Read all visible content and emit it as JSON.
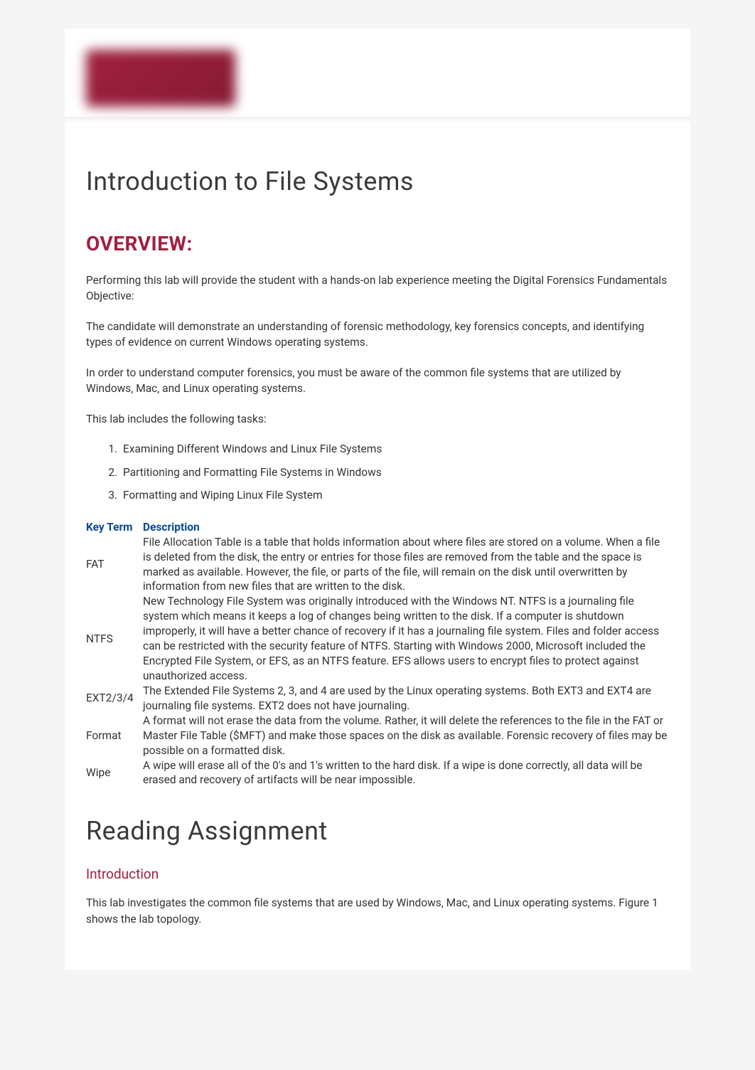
{
  "logo": {
    "alt": "INFOSEC"
  },
  "title": "Introduction to File Systems",
  "overview": {
    "heading": "OVERVIEW:",
    "p1": "Performing this lab will provide the student with a hands-on lab experience meeting the Digital Forensics Fundamentals Objective:",
    "p2": "The candidate will demonstrate an understanding of forensic methodology, key forensics concepts, and identifying types of evidence on current Windows operating systems.",
    "p3": "In order to understand computer forensics, you must be aware of the common file systems that are utilized by Windows, Mac, and Linux operating systems.",
    "p4": "This lab includes the following tasks:",
    "tasks": [
      "Examining Different Windows and Linux File Systems",
      "Partitioning and Formatting File Systems in Windows",
      "Formatting and Wiping Linux File System"
    ]
  },
  "keyTerms": {
    "header": {
      "term": "Key Term",
      "desc": "Description"
    },
    "rows": [
      {
        "term": "FAT",
        "desc": "File Allocation Table is a table that holds information about where files are stored on a volume. When a file is deleted from the disk, the entry or entries for those files are removed from the table and the space is marked as available. However, the file, or parts of the file, will remain on the disk until overwritten by information from new files that are written to the disk."
      },
      {
        "term": "NTFS",
        "desc": "New Technology File System was originally introduced with the Windows NT. NTFS is a journaling file system which means it keeps a log of changes being written to the disk. If a computer is shutdown improperly, it will have a better chance of recovery if it has a journaling file system. Files and folder access can be restricted with the security feature of NTFS. Starting with Windows 2000, Microsoft included the Encrypted File System, or EFS, as an NTFS feature. EFS allows users to encrypt files to protect against unauthorized access."
      },
      {
        "term": "EXT2/3/4",
        "desc": "The Extended File Systems 2, 3, and 4 are used by the Linux operating systems. Both EXT3 and EXT4 are journaling file systems. EXT2 does not have journaling."
      },
      {
        "term": "Format",
        "desc": "A format will not erase the data from the volume. Rather, it will delete the references to the file in the FAT or Master File Table ($MFT) and make those spaces on the disk as available. Forensic recovery of files may be possible on a formatted disk."
      },
      {
        "term": "Wipe",
        "desc": "A wipe will erase all of the 0's and 1's written to the hard disk. If a wipe is done correctly, all data will be erased and recovery of artifacts will be near impossible."
      }
    ]
  },
  "reading": {
    "heading": "Reading Assignment",
    "introHeading": "Introduction",
    "p1": "This lab investigates the common file systems that are used by Windows, Mac, and Linux operating systems. Figure 1 shows the lab topology."
  }
}
